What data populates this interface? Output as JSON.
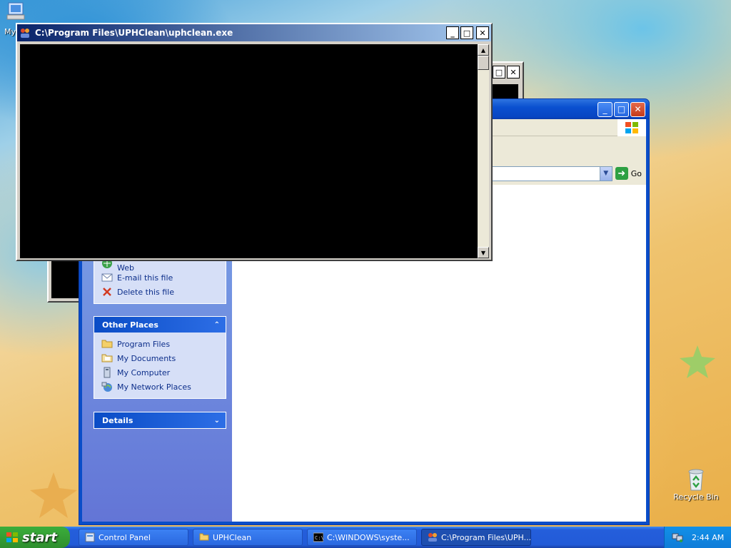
{
  "desktop": {
    "my_computer_label": "My",
    "recycle_bin_label": "Recycle Bin"
  },
  "console_window": {
    "title": "C:\\Program Files\\UPHClean\\uphclean.exe"
  },
  "explorer": {
    "go_label": "Go",
    "file_tasks": {
      "items": [
        {
          "label": "Publish this file to the Web",
          "icon": "web-publish-icon"
        },
        {
          "label": "E-mail this file",
          "icon": "email-icon"
        },
        {
          "label": "Delete this file",
          "icon": "delete-icon"
        }
      ]
    },
    "other_places": {
      "header": "Other Places",
      "items": [
        {
          "label": "Program Files",
          "icon": "folder-icon"
        },
        {
          "label": "My Documents",
          "icon": "my-documents-icon"
        },
        {
          "label": "My Computer",
          "icon": "my-computer-icon"
        },
        {
          "label": "My Network Places",
          "icon": "network-places-icon"
        }
      ]
    },
    "details": {
      "header": "Details"
    }
  },
  "taskbar": {
    "start_label": "start",
    "tasks": [
      {
        "label": "Control Panel",
        "icon": "control-panel-icon",
        "active": false
      },
      {
        "label": "UPHClean",
        "icon": "folder-icon",
        "active": false
      },
      {
        "label": "C:\\WINDOWS\\syste...",
        "icon": "cmd-icon",
        "active": false
      },
      {
        "label": "C:\\Program Files\\UPH...",
        "icon": "uphclean-icon",
        "active": true
      }
    ],
    "clock": "2:44 AM"
  },
  "colors": {
    "xp_blue": "#0a4dc8",
    "sidebar_link": "#0c2e8a",
    "start_green": "#2e8e2e"
  }
}
